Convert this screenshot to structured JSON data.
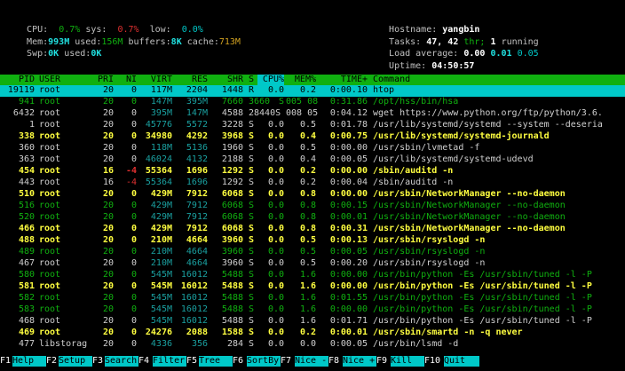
{
  "meters": {
    "cpu_label": "CPU:",
    "cpu_usr": "0.7%",
    "sys_label": "sys:",
    "cpu_sys": "0.7%",
    "low_label": "low:",
    "cpu_low": "0.0%",
    "mem_label": "Mem:",
    "mem_total": "993M",
    "used_label": "used:",
    "mem_used": "156M",
    "buffers_label": "buffers:",
    "mem_buffers": "8K",
    "cache_label": "cache:",
    "mem_cache": "713M",
    "swp_label": "Swp:",
    "swp_total": "0K",
    "swp_used_label": "used:",
    "swp_used": "0K"
  },
  "sysinfo": {
    "hostname_label": "Hostname:",
    "hostname": "yangbin",
    "tasks_label": "Tasks:",
    "tasks": "47,",
    "thr": "42",
    "thr_label": "thr;",
    "running": "1",
    "running_label": "running",
    "load_label": "Load average:",
    "load1": "0.00",
    "load5": "0.01",
    "load15": "0.05",
    "uptime_label": "Uptime:",
    "uptime": "04:50:57"
  },
  "columns": [
    "PID",
    "USER",
    "PRI",
    "NI",
    "VIRT",
    "RES",
    "SHR",
    "S",
    "CPU%",
    "MEM%",
    "TIME+",
    "Command"
  ],
  "processes": [
    {
      "pid": "19119",
      "user": "root",
      "pri": "20",
      "ni": "0",
      "virt": "117M",
      "res": "2204",
      "shr": "1448",
      "s": "R",
      "cpu": "0.0",
      "mem": "0.2",
      "time": "0:00.10",
      "cmd": "htop",
      "type": "selected"
    },
    {
      "pid": "941",
      "user": "root",
      "pri": "20",
      "ni": "0",
      "virt": "147M",
      "res": "395M",
      "shr": "7660",
      "s": "3660",
      "cpu": "S",
      "mem": "005 08",
      "time": "0:31.86",
      "cmd": "/opt/hss/bin/hsa",
      "type": "thr"
    },
    {
      "pid": "6432",
      "user": "root",
      "pri": "20",
      "ni": "0",
      "virt": "395M",
      "res": "147M",
      "shr": "4588",
      "s": "28440S",
      "cpu": "",
      "mem": "008 05",
      "time": "0:04.12",
      "cmd": "wget https://www.python.org/ftp/python/3.6.",
      "type": "norm"
    },
    {
      "pid": "1",
      "user": "root",
      "pri": "20",
      "ni": "0",
      "virt": "45776",
      "res": "5572",
      "shr": "3228",
      "s": "S",
      "cpu": "0.0",
      "mem": "0.5",
      "time": "0:01.78",
      "cmd": "/usr/lib/systemd/systemd --system --deseria",
      "type": "norm"
    },
    {
      "pid": "338",
      "user": "root",
      "pri": "20",
      "ni": "0",
      "virt": "34980",
      "res": "4292",
      "shr": "3968",
      "s": "S",
      "cpu": "0.0",
      "mem": "0.4",
      "time": "0:00.75",
      "cmd": "/usr/lib/systemd/systemd-journald",
      "type": "bold"
    },
    {
      "pid": "360",
      "user": "root",
      "pri": "20",
      "ni": "0",
      "virt": "118M",
      "res": "5136",
      "shr": "1960",
      "s": "S",
      "cpu": "0.0",
      "mem": "0.5",
      "time": "0:00.00",
      "cmd": "/usr/sbin/lvmetad -f",
      "type": "norm"
    },
    {
      "pid": "363",
      "user": "root",
      "pri": "20",
      "ni": "0",
      "virt": "46024",
      "res": "4132",
      "shr": "2188",
      "s": "S",
      "cpu": "0.0",
      "mem": "0.4",
      "time": "0:00.05",
      "cmd": "/usr/lib/systemd/systemd-udevd",
      "type": "norm"
    },
    {
      "pid": "454",
      "user": "root",
      "pri": "16",
      "ni": "-4",
      "virt": "55364",
      "res": "1696",
      "shr": "1292",
      "s": "S",
      "cpu": "0.0",
      "mem": "0.2",
      "time": "0:00.00",
      "cmd": "/sbin/auditd -n",
      "type": "bold"
    },
    {
      "pid": "443",
      "user": "root",
      "pri": "16",
      "ni": "-4",
      "virt": "55364",
      "res": "1696",
      "shr": "1292",
      "s": "S",
      "cpu": "0.0",
      "mem": "0.2",
      "time": "0:00.04",
      "cmd": "/sbin/auditd -n",
      "type": "norm"
    },
    {
      "pid": "510",
      "user": "root",
      "pri": "20",
      "ni": "0",
      "virt": "429M",
      "res": "7912",
      "shr": "6068",
      "s": "S",
      "cpu": "0.0",
      "mem": "0.8",
      "time": "0:00.00",
      "cmd": "/usr/sbin/NetworkManager --no-daemon",
      "type": "bold"
    },
    {
      "pid": "516",
      "user": "root",
      "pri": "20",
      "ni": "0",
      "virt": "429M",
      "res": "7912",
      "shr": "6068",
      "s": "S",
      "cpu": "0.0",
      "mem": "0.8",
      "time": "0:00.15",
      "cmd": "/usr/sbin/NetworkManager --no-daemon",
      "type": "thr"
    },
    {
      "pid": "520",
      "user": "root",
      "pri": "20",
      "ni": "0",
      "virt": "429M",
      "res": "7912",
      "shr": "6068",
      "s": "S",
      "cpu": "0.0",
      "mem": "0.8",
      "time": "0:00.01",
      "cmd": "/usr/sbin/NetworkManager --no-daemon",
      "type": "thr"
    },
    {
      "pid": "466",
      "user": "root",
      "pri": "20",
      "ni": "0",
      "virt": "429M",
      "res": "7912",
      "shr": "6068",
      "s": "S",
      "cpu": "0.0",
      "mem": "0.8",
      "time": "0:00.31",
      "cmd": "/usr/sbin/NetworkManager --no-daemon",
      "type": "bold"
    },
    {
      "pid": "488",
      "user": "root",
      "pri": "20",
      "ni": "0",
      "virt": "210M",
      "res": "4664",
      "shr": "3960",
      "s": "S",
      "cpu": "0.0",
      "mem": "0.5",
      "time": "0:00.13",
      "cmd": "/usr/sbin/rsyslogd -n",
      "type": "bold"
    },
    {
      "pid": "489",
      "user": "root",
      "pri": "20",
      "ni": "0",
      "virt": "210M",
      "res": "4664",
      "shr": "3960",
      "s": "S",
      "cpu": "0.0",
      "mem": "0.5",
      "time": "0:00.05",
      "cmd": "/usr/sbin/rsyslogd -n",
      "type": "thr"
    },
    {
      "pid": "467",
      "user": "root",
      "pri": "20",
      "ni": "0",
      "virt": "210M",
      "res": "4664",
      "shr": "3960",
      "s": "S",
      "cpu": "0.0",
      "mem": "0.5",
      "time": "0:00.20",
      "cmd": "/usr/sbin/rsyslogd -n",
      "type": "norm"
    },
    {
      "pid": "580",
      "user": "root",
      "pri": "20",
      "ni": "0",
      "virt": "545M",
      "res": "16012",
      "shr": "5488",
      "s": "S",
      "cpu": "0.0",
      "mem": "1.6",
      "time": "0:00.00",
      "cmd": "/usr/bin/python -Es /usr/sbin/tuned -l -P",
      "type": "thr"
    },
    {
      "pid": "581",
      "user": "root",
      "pri": "20",
      "ni": "0",
      "virt": "545M",
      "res": "16012",
      "shr": "5488",
      "s": "S",
      "cpu": "0.0",
      "mem": "1.6",
      "time": "0:00.00",
      "cmd": "/usr/bin/python -Es /usr/sbin/tuned -l -P",
      "type": "bold"
    },
    {
      "pid": "582",
      "user": "root",
      "pri": "20",
      "ni": "0",
      "virt": "545M",
      "res": "16012",
      "shr": "5488",
      "s": "S",
      "cpu": "0.0",
      "mem": "1.6",
      "time": "0:01.55",
      "cmd": "/usr/bin/python -Es /usr/sbin/tuned -l -P",
      "type": "thr"
    },
    {
      "pid": "583",
      "user": "root",
      "pri": "20",
      "ni": "0",
      "virt": "545M",
      "res": "16012",
      "shr": "5488",
      "s": "S",
      "cpu": "0.0",
      "mem": "1.6",
      "time": "0:00.00",
      "cmd": "/usr/bin/python -Es /usr/sbin/tuned -l -P",
      "type": "thr"
    },
    {
      "pid": "468",
      "user": "root",
      "pri": "20",
      "ni": "0",
      "virt": "545M",
      "res": "16012",
      "shr": "5488",
      "s": "S",
      "cpu": "0.0",
      "mem": "1.6",
      "time": "0:01.71",
      "cmd": "/usr/bin/python -Es /usr/sbin/tuned -l -P",
      "type": "norm"
    },
    {
      "pid": "469",
      "user": "root",
      "pri": "20",
      "ni": "0",
      "virt": "24276",
      "res": "2088",
      "shr": "1588",
      "s": "S",
      "cpu": "0.0",
      "mem": "0.2",
      "time": "0:00.01",
      "cmd": "/usr/sbin/smartd -n -q never",
      "type": "bold"
    },
    {
      "pid": "477",
      "user": "libstorag",
      "pri": "20",
      "ni": "0",
      "virt": "4336",
      "res": "356",
      "shr": "284",
      "s": "S",
      "cpu": "0.0",
      "mem": "0.0",
      "time": "0:00.05",
      "cmd": "/usr/bin/lsmd -d",
      "type": "norm"
    }
  ],
  "footer": [
    {
      "key": "F1",
      "label": "Help"
    },
    {
      "key": "F2",
      "label": "Setup"
    },
    {
      "key": "F3",
      "label": "Search"
    },
    {
      "key": "F4",
      "label": "Filter"
    },
    {
      "key": "F5",
      "label": "Tree"
    },
    {
      "key": "F6",
      "label": "SortBy"
    },
    {
      "key": "F7",
      "label": "Nice -"
    },
    {
      "key": "F8",
      "label": "Nice +"
    },
    {
      "key": "F9",
      "label": "Kill"
    },
    {
      "key": "F10",
      "label": "Quit"
    }
  ],
  "colors": {
    "header_bg": "#10b010",
    "selected_bg": "#00c8c8",
    "accent": "#00c8c8"
  }
}
